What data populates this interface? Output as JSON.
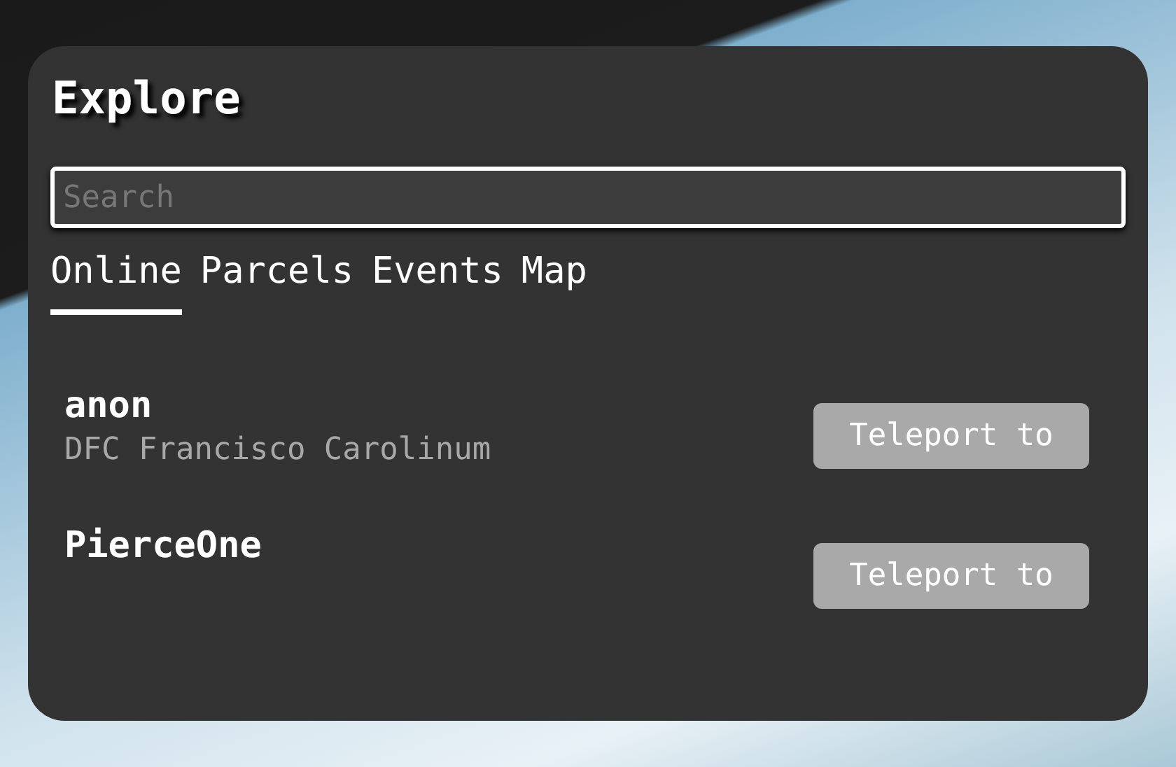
{
  "panel": {
    "title": "Explore"
  },
  "search": {
    "placeholder": "Search"
  },
  "tabs": [
    {
      "label": "Online",
      "selected": true
    },
    {
      "label": "Parcels",
      "selected": false
    },
    {
      "label": "Events",
      "selected": false
    },
    {
      "label": "Map",
      "selected": false
    }
  ],
  "users": [
    {
      "name": "anon",
      "location": "DFC Francisco Carolinum",
      "action": "Teleport to"
    },
    {
      "name": "PierceOne",
      "action": "Teleport to"
    }
  ]
}
